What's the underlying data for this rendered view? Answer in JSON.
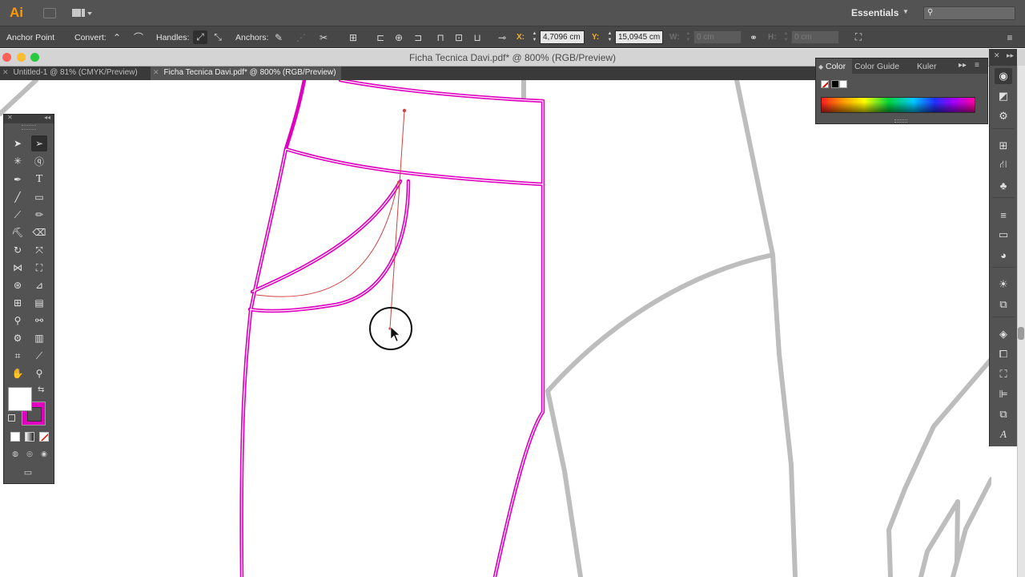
{
  "app": {
    "logo": "Ai",
    "workspace": "Essentials"
  },
  "control_bar": {
    "tool_name": "Anchor Point",
    "convert_label": "Convert:",
    "handles_label": "Handles:",
    "anchors_label": "Anchors:",
    "x_label": "X:",
    "x_value": "4,7096 cm",
    "y_label": "Y:",
    "y_value": "15,0945 cm",
    "w_label": "W:",
    "w_value": "0 cm",
    "h_label": "H:",
    "h_value": "0 cm"
  },
  "document": {
    "title": "Ficha Tecnica Davi.pdf* @ 800% (RGB/Preview)",
    "tabs": [
      {
        "label": "Untitled-1 @ 81% (CMYK/Preview)",
        "active": false
      },
      {
        "label": "Ficha Tecnica Davi.pdf* @ 800% (RGB/Preview)",
        "active": true
      }
    ]
  },
  "color_panel": {
    "tabs": [
      "Color",
      "Color Guide",
      "Kuler"
    ],
    "active_tab": "Color"
  },
  "colors": {
    "stroke": "#e000c0",
    "fill": "#ffffff",
    "path_gray": "#bdbdbd",
    "guide_red": "#d44040",
    "traffic_red": "#ff5f57",
    "traffic_yellow": "#febc2e",
    "traffic_green": "#28c840"
  },
  "icons": {
    "tools": [
      "selection-tool",
      "direct-selection-tool",
      "magic-wand-tool",
      "lasso-tool",
      "pen-tool",
      "type-tool",
      "line-tool",
      "rectangle-tool",
      "paintbrush-tool",
      "pencil-tool",
      "blob-brush-tool",
      "eraser-tool",
      "rotate-tool",
      "scale-tool",
      "width-tool",
      "free-transform-tool",
      "shape-builder-tool",
      "perspective-grid-tool",
      "mesh-tool",
      "gradient-tool",
      "eyedropper-tool",
      "blend-tool",
      "symbol-sprayer-tool",
      "column-graph-tool",
      "artboard-tool",
      "slice-tool",
      "hand-tool",
      "zoom-tool"
    ]
  }
}
